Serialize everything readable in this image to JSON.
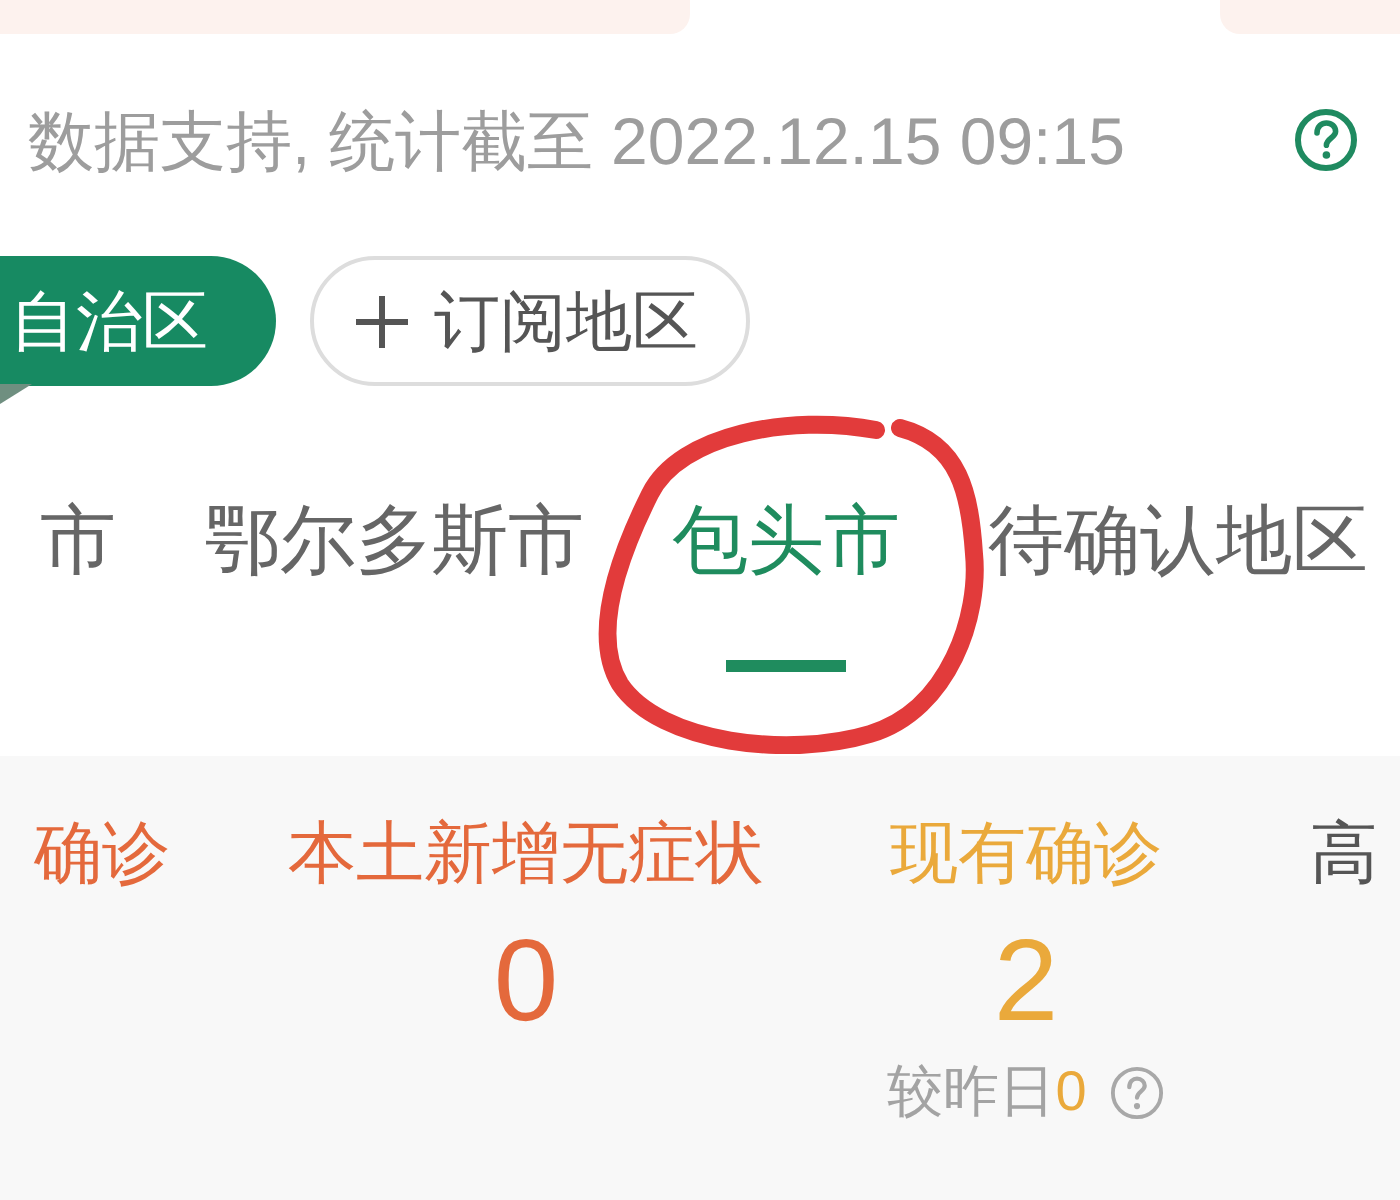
{
  "update_line": {
    "text": "数据支持, 统计截至 2022.12.15 09:15"
  },
  "region_chips": [
    {
      "kind": "region",
      "label": "自治区",
      "selected": true
    },
    {
      "kind": "add",
      "label": "订阅地区",
      "selected": false
    }
  ],
  "city_tabs": [
    {
      "label": "市",
      "selected": false
    },
    {
      "label": "鄂尔多斯市",
      "selected": false
    },
    {
      "label": "包头市",
      "selected": true
    },
    {
      "label": "待确认地区",
      "selected": false
    }
  ],
  "stats": [
    {
      "label": "确诊",
      "color": "#e4693c"
    },
    {
      "label": "本土新增无症状",
      "value": "0",
      "color": "#e4693c"
    },
    {
      "label": "现有确诊",
      "value": "2",
      "color": "#eaa93b",
      "compare_label": "较昨日",
      "compare_value": "0"
    },
    {
      "label": "高",
      "color": "#555555"
    }
  ]
}
